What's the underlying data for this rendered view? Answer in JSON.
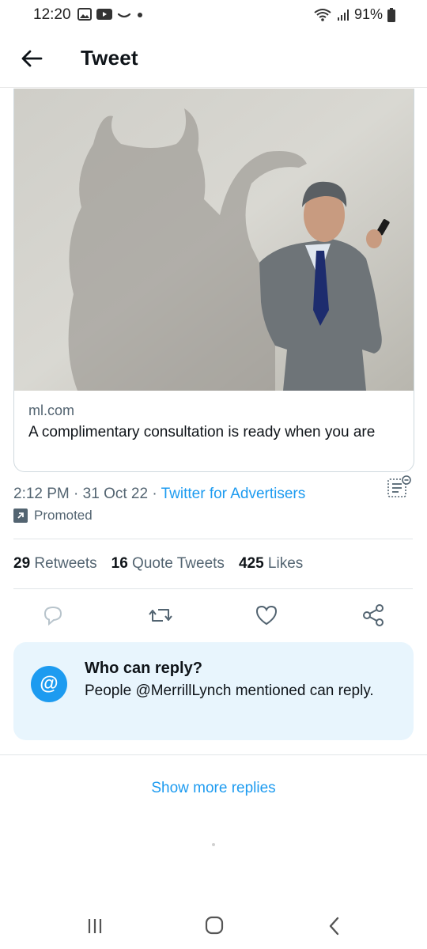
{
  "status": {
    "time": "12:20",
    "battery": "91%"
  },
  "header": {
    "title": "Tweet"
  },
  "card": {
    "domain": "ml.com",
    "text": "A complimentary consultation is ready when you are"
  },
  "meta": {
    "time": "2:12 PM",
    "sep1": " · ",
    "date": "31 Oct 22",
    "sep2": " · ",
    "source": "Twitter for Advertisers",
    "promoted": "Promoted"
  },
  "stats": {
    "retweets_count": "29",
    "retweets_label": "Retweets",
    "quotes_count": "16",
    "quotes_label": "Quote Tweets",
    "likes_count": "425",
    "likes_label": "Likes"
  },
  "who_can_reply": {
    "icon_text": "@",
    "title": "Who can reply?",
    "text": "People @MerrillLynch mentioned can reply."
  },
  "show_more": "Show more replies",
  "colors": {
    "accent": "#1d9bf0",
    "muted": "#536471",
    "panel": "#e8f5fd"
  }
}
